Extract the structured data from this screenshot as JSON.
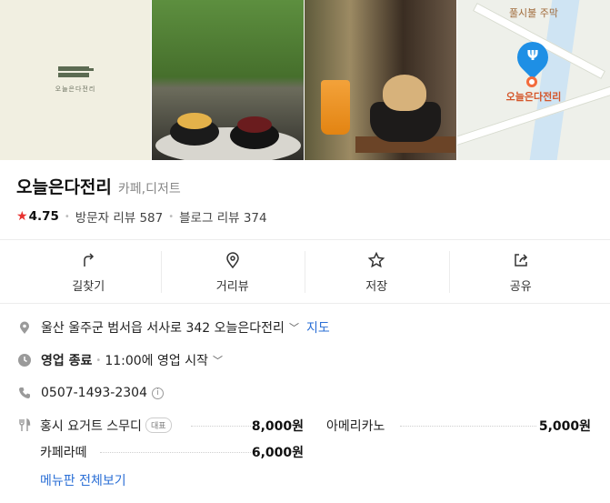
{
  "photos": {
    "logo_text": "오늘은다전리",
    "map": {
      "top_label": "풀시불 주막",
      "pin_label": "오늘은다전리"
    }
  },
  "place": {
    "name": "오늘은다전리",
    "category": "카페,디저트",
    "rating": "4.75",
    "visitor_reviews": "방문자 리뷰 587",
    "blog_reviews": "블로그 리뷰 374"
  },
  "actions": [
    {
      "label": "길찾기",
      "icon": "directions-icon"
    },
    {
      "label": "거리뷰",
      "icon": "street-view-icon"
    },
    {
      "label": "저장",
      "icon": "star-outline-icon"
    },
    {
      "label": "공유",
      "icon": "share-icon"
    }
  ],
  "info": {
    "address": "울산 울주군 범서읍 서사로 342 오늘은다전리",
    "map_link": "지도",
    "status": "영업 종료",
    "hours": "11:00에 영업 시작",
    "phone": "0507-1493-2304"
  },
  "menu": {
    "items": [
      {
        "name": "홍시 요거트 스무디",
        "badge": "대표",
        "price": "8,000원"
      },
      {
        "name": "카페라떼",
        "price": "6,000원"
      },
      {
        "name": "아메리카노",
        "price": "5,000원"
      }
    ],
    "more_label": "메뉴판 전체보기"
  },
  "colors": {
    "accent_link": "#2b6fd6",
    "star": "#e8312f",
    "map_pin": "#1e8fe5"
  }
}
